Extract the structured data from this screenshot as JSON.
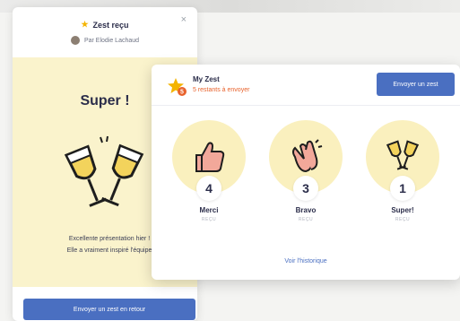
{
  "left_card": {
    "close_label": "×",
    "title": "Zest reçu",
    "from": "Par Elodie Lachaud",
    "headline": "Super !",
    "message_line1": "Excellente présentation hier !",
    "message_line2": "Elle a vraiment inspiré l'équipe",
    "reply_button": "Envoyer un zest en retour"
  },
  "right_card": {
    "title": "My Zest",
    "remaining": "5 restants à envoyer",
    "remaining_count": "5",
    "send_button": "Envoyer un zest",
    "history_link": "Voir l'historique",
    "zests": [
      {
        "count": "4",
        "label": "Merci",
        "small": "REÇU",
        "icon": "thumbs-up-icon"
      },
      {
        "count": "3",
        "label": "Bravo",
        "small": "REÇU",
        "icon": "clapping-hands-icon"
      },
      {
        "count": "1",
        "label": "Super!",
        "small": "REÇU",
        "icon": "champagne-glasses-icon"
      }
    ]
  },
  "colors": {
    "accent_blue": "#4a6fc1",
    "pale_yellow": "#faf3cc",
    "star_yellow": "#f4b400",
    "orange_text": "#e8622c"
  }
}
